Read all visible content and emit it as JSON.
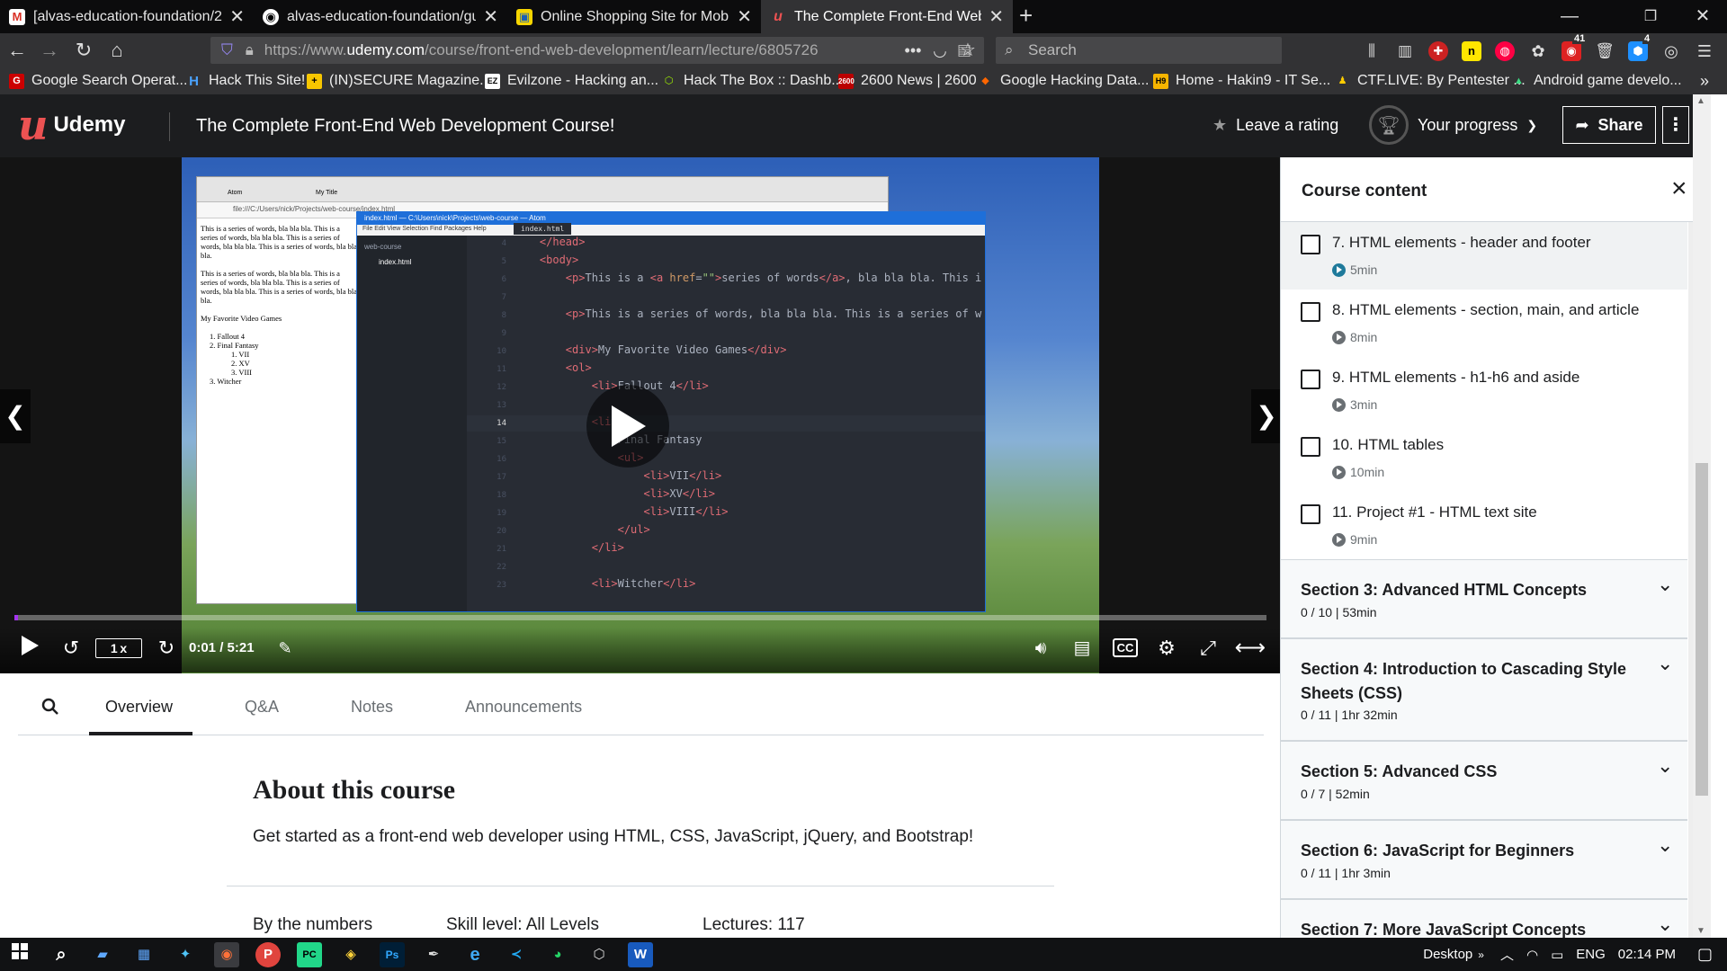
{
  "browser": {
    "tabs": [
      {
        "title": "[alvas-education-foundation/2",
        "icon": "gmail-icon"
      },
      {
        "title": "alvas-education-foundation/gu",
        "icon": "github-icon"
      },
      {
        "title": "Online Shopping Site for Mobi",
        "icon": "shop-icon"
      },
      {
        "title": "The Complete Front-End Web D",
        "icon": "udemy-icon"
      }
    ],
    "url_prefix": "https://www.",
    "url_domain": "udemy.com",
    "url_path": "/course/front-end-web-development/learn/lecture/6805726",
    "search_placeholder": "Search",
    "badges": {
      "notifications": "41",
      "extension": "4"
    },
    "bookmarks": [
      "Google Search Operat...",
      "Hack This Site!",
      "(IN)SECURE Magazine...",
      "Evilzone - Hacking an...",
      "Hack The Box :: Dashb...",
      "2600 News | 2600",
      "Google Hacking Data...",
      "Home - Hakin9 - IT Se...",
      "CTF.LIVE: By Pentester ...",
      "Android game develo..."
    ]
  },
  "header": {
    "brand": "Udemy",
    "course_title": "The Complete Front-End Web Development Course!",
    "rating_label": "Leave a rating",
    "progress_label": "Your progress",
    "share_label": "Share"
  },
  "video": {
    "playback_rate": "1 x",
    "time": "0:01 / 5:21",
    "progress_fraction": 0.003,
    "browser_tab1": "Atom",
    "browser_tab2": "My Title",
    "editor_title": "index.html — C:\\Users\\nick\\Projects\\web-course — Atom",
    "editor_menu": "File  Edit  View  Selection  Find  Packages  Help",
    "editor_tab": "index.html",
    "tree_folder": "web-course",
    "tree_file": "index.html",
    "page_text": [
      "This is a series of words, bla bla bla. This is a series of words, bla bla bla. This is a series of words, bla bla bla. This is a series of words, bla bla bla.",
      "This is a series of words, bla bla bla. This is a series of words, bla bla bla. This is a series of words, bla bla bla. This is a series of words, bla bla bla.",
      "My Favorite Video Games",
      "1. Fallout 4",
      "2. Final Fantasy",
      "1. VII",
      "2. XV",
      "3. VIII",
      "3. Witcher"
    ]
  },
  "course_tabs": [
    "Overview",
    "Q&A",
    "Notes",
    "Announcements"
  ],
  "about": {
    "heading": "About this course",
    "description": "Get started as a front-end web developer using HTML, CSS, JavaScript, jQuery, and Bootstrap!",
    "by_numbers": "By the numbers",
    "skill_level": "Skill level: All Levels",
    "lectures": "Lectures: 117"
  },
  "sidebar": {
    "heading": "Course content",
    "lectures": [
      {
        "title": "7. HTML elements - header and footer",
        "duration": "5min",
        "current": true
      },
      {
        "title": "8. HTML elements - section, main, and article",
        "duration": "8min",
        "current": false
      },
      {
        "title": "9. HTML elements - h1-h6 and aside",
        "duration": "3min",
        "current": false
      },
      {
        "title": "10. HTML tables",
        "duration": "10min",
        "current": false
      },
      {
        "title": "11. Project #1 - HTML text site",
        "duration": "9min",
        "current": false
      }
    ],
    "sections": [
      {
        "title": "Section 3: Advanced HTML Concepts",
        "meta": "0 / 10 | 53min"
      },
      {
        "title": "Section 4: Introduction to Cascading Style Sheets (CSS)",
        "meta": "0 / 11 | 1hr 32min"
      },
      {
        "title": "Section 5: Advanced CSS",
        "meta": "0 / 7 | 52min"
      },
      {
        "title": "Section 6: JavaScript for Beginners",
        "meta": "0 / 11 | 1hr 3min"
      },
      {
        "title": "Section 7: More JavaScript Concepts",
        "meta": ""
      }
    ]
  },
  "taskbar": {
    "desktop_label": "Desktop",
    "language": "ENG",
    "clock": "02:14 PM"
  },
  "colors": {
    "udemy_red": "#ec5252",
    "udemy_dark": "#1c1d1f",
    "accent_purple": "#a435f0"
  }
}
